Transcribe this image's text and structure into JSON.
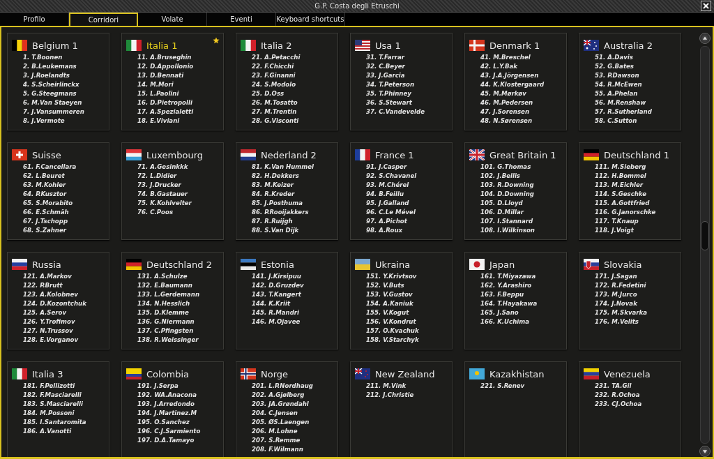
{
  "window": {
    "title": "G.P. Costa degli Etruschi"
  },
  "tabs": [
    {
      "label": "Profilo",
      "selected": false
    },
    {
      "label": "Corridori",
      "selected": true
    },
    {
      "label": "Volate",
      "selected": false
    },
    {
      "label": "Eventi",
      "selected": false
    },
    {
      "label": "Keyboard shortcuts",
      "selected": false
    }
  ],
  "teams": [
    {
      "name": "Belgium 1",
      "kind": "be",
      "own": false,
      "riders": [
        "1. T.Boonen",
        "2. B.Leukemans",
        "3. J.Roelandts",
        "4. S.Scheirlinckx",
        "5. G.Steegmans",
        "6. M.Van Staeyen",
        "7. J.Vansummeren",
        "8. J.Vermote"
      ]
    },
    {
      "name": "Italia 1",
      "kind": "it",
      "own": true,
      "riders": [
        "11. A.Bruseghin",
        "12. D.Appollonio",
        "13. D.Bennati",
        "14. M.Mori",
        "15. L.Paolini",
        "16. D.Pietropolli",
        "17. A.Spezialetti",
        "18. E.Viviani"
      ]
    },
    {
      "name": "Italia 2",
      "kind": "it",
      "own": false,
      "riders": [
        "21. A.Petacchi",
        "22. F.Chicchi",
        "23. F.Ginanni",
        "24. S.Modolo",
        "25. D.Oss",
        "26. M.Tosatto",
        "27. M.Trentin",
        "28. G.Visconti"
      ]
    },
    {
      "name": "Usa 1",
      "kind": "us",
      "own": false,
      "riders": [
        "31. T.Farrar",
        "32. C.Beyer",
        "33. J.Garcia",
        "34. T.Peterson",
        "35. T.Phinney",
        "36. S.Stewart",
        "37. C.Vandevelde"
      ]
    },
    {
      "name": "Denmark 1",
      "kind": "dk",
      "own": false,
      "riders": [
        "41. M.Breschel",
        "42. L.Y.Bak",
        "43. J.A.Jörgensen",
        "44. K.Klostergaard",
        "45. M.Mørkøv",
        "46. M.Pedersen",
        "47. J.Sorensen",
        "48. N.Sørensen"
      ]
    },
    {
      "name": "Australia 2",
      "kind": "au",
      "own": false,
      "riders": [
        "51. A.Davis",
        "52. G.Bates",
        "53. P.Dawson",
        "54. R.McEwen",
        "55. A.Phelan",
        "56. M.Renshaw",
        "57. R.Sutherland",
        "58. C.Sutton"
      ]
    },
    {
      "name": "Suisse",
      "kind": "ch",
      "own": false,
      "riders": [
        "61. F.Cancellara",
        "62. L.Beuret",
        "63. M.Kohler",
        "64. P.Kusztor",
        "65. S.Morabito",
        "66. E.Schmäh",
        "67. J.Tschopp",
        "68. S.Zahner"
      ]
    },
    {
      "name": "Luxembourg",
      "kind": "lu",
      "own": false,
      "riders": [
        "71. A.Gesinkkk",
        "72. L.Didier",
        "73. J.Drucker",
        "74. B.Gastauer",
        "75. K.Kohlvelter",
        "76. C.Poos"
      ]
    },
    {
      "name": "Nederland 2",
      "kind": "nl",
      "own": false,
      "riders": [
        "81. K.Van Hummel",
        "82. H.Dekkers",
        "83. M.Keizer",
        "84. R.Kreder",
        "85. J.Posthuma",
        "86. P.Rooijakkers",
        "87. R.Ruijgh",
        "88. S.Van Dijk"
      ]
    },
    {
      "name": "France 1",
      "kind": "fr",
      "own": false,
      "riders": [
        "91. J.Casper",
        "92. S.Chavanel",
        "93. M.Chérel",
        "94. B.Feillu",
        "95. J.Galland",
        "96. C.Le Mével",
        "97. A.Pichot",
        "98. A.Roux"
      ]
    },
    {
      "name": "Great Britain 1",
      "kind": "gb",
      "own": false,
      "riders": [
        "101. G.Thomas",
        "102. J.Bellis",
        "103. R.Downing",
        "104. D.Downing",
        "105. D.Lloyd",
        "106. D.Millar",
        "107. I.Stannard",
        "108. I.Wilkinson"
      ]
    },
    {
      "name": "Deutschland 1",
      "kind": "de",
      "own": false,
      "riders": [
        "111. M.Sieberg",
        "112. H.Bommel",
        "113. M.Eichler",
        "114. S.Geschke",
        "115. A.Gottfried",
        "116. G.Janorschke",
        "117. T.Knaup",
        "118. J.Voigt"
      ]
    },
    {
      "name": "Russia",
      "kind": "ru",
      "own": false,
      "riders": [
        "121. A.Markov",
        "122. P.Brutt",
        "123. A.Kolobnev",
        "124. D.Kozontchuk",
        "125. A.Serov",
        "126. Y.Trofimov",
        "127. N.Trussov",
        "128. E.Vorganov"
      ]
    },
    {
      "name": "Deutschland 2",
      "kind": "de",
      "own": false,
      "riders": [
        "131. A.Schulze",
        "132. E.Baumann",
        "133. L.Gerdemann",
        "134. N.Hesslich",
        "135. D.Klemme",
        "136. G.Niermann",
        "137. C.Pfingsten",
        "138. R.Weissinger"
      ]
    },
    {
      "name": "Estonia",
      "kind": "ee",
      "own": false,
      "riders": [
        "141. J.Kirsipuu",
        "142. D.Gruzdev",
        "143. T.Kangert",
        "144. K.Kriit",
        "145. R.Mandri",
        "146. M.Ojavee"
      ]
    },
    {
      "name": "Ukraina",
      "kind": "ua",
      "own": false,
      "riders": [
        "151. Y.Krivtsov",
        "152. V.Buts",
        "153. V.Gustov",
        "154. A.Kaniuk",
        "155. V.Kogut",
        "156. V.Kondrut",
        "157. O.Kvachuk",
        "158. V.Starchyk"
      ]
    },
    {
      "name": "Japan",
      "kind": "jp",
      "own": false,
      "riders": [
        "161. T.Miyazawa",
        "162. Y.Arashiro",
        "163. F.Beppu",
        "164. T.Hayakawa",
        "165. J.Sano",
        "166. K.Uchima"
      ]
    },
    {
      "name": "Slovakia",
      "kind": "sk",
      "own": false,
      "riders": [
        "171. J.Sagan",
        "172. R.Fedetini",
        "173. M.Jurco",
        "174. J.Novak",
        "175. M.Skvarka",
        "176. M.Velits"
      ]
    },
    {
      "name": "Italia 3",
      "kind": "it",
      "own": false,
      "riders": [
        "181. F.Pellizotti",
        "182. F.Masciarelli",
        "183. S.Masciarelli",
        "184. M.Possoni",
        "185. I.Santaromita",
        "186. A.Vanotti"
      ]
    },
    {
      "name": "Colombia",
      "kind": "co",
      "own": false,
      "riders": [
        "191. J.Serpa",
        "192. WA.Anacona",
        "193. J.Arredondo",
        "194. J.Martinez.M",
        "195. O.Sanchez",
        "196. C.J.Sarmiento",
        "197. D.A.Tamayo"
      ]
    },
    {
      "name": "Norge",
      "kind": "no",
      "own": false,
      "riders": [
        "201. L.P.Nordhaug",
        "202. A.Gjølberg",
        "203. JA.Grøndahl",
        "204. C.Jensen",
        "205. ØS.Laengen",
        "206. M.Lohne",
        "207. S.Remme",
        "208. F.Wilmann"
      ]
    },
    {
      "name": "New Zealand",
      "kind": "nz",
      "own": false,
      "riders": [
        "211. M.Vink",
        "212. J.Christie"
      ]
    },
    {
      "name": "Kazakhistan",
      "kind": "kz",
      "own": false,
      "riders": [
        "221. S.Renev"
      ]
    },
    {
      "name": "Venezuela",
      "kind": "ve",
      "own": false,
      "riders": [
        "231. TA.Gil",
        "232. R.Ochoa",
        "233. CJ.Ochoa"
      ]
    }
  ]
}
